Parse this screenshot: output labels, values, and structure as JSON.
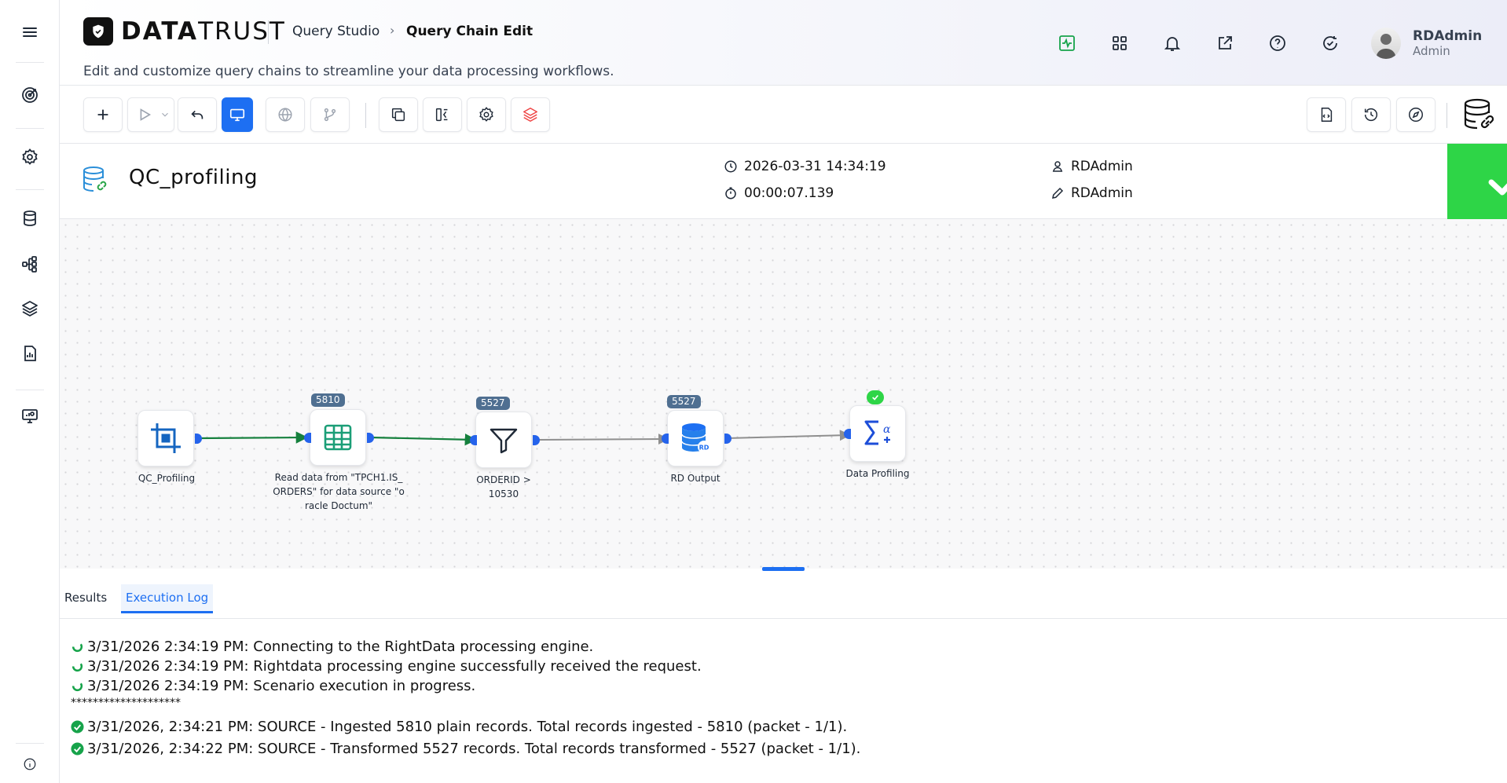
{
  "header": {
    "logo_text_bold": "DATA",
    "logo_text_rest": "TRUST",
    "breadcrumb_parent": "Query Studio",
    "breadcrumb_current": "Query Chain Edit",
    "subtitle": "Edit and customize query chains to streamline your data processing workflows.",
    "user_name": "RDAdmin",
    "user_role": "Admin",
    "icons": [
      "activity-icon",
      "grid-icon",
      "bell-icon",
      "external-link-icon",
      "help-icon",
      "refresh-check-icon"
    ]
  },
  "sidebar": {
    "items": [
      "menu-icon",
      "target-icon",
      "settings-icon",
      "database-icon",
      "hierarchy-icon",
      "layers-icon",
      "report-icon",
      "monitor-icon",
      "info-icon"
    ]
  },
  "query": {
    "title": "QC_profiling",
    "run_time": "2026-03-31 14:34:19",
    "duration": "00:00:07.139",
    "created_by": "RDAdmin",
    "modified_by": "RDAdmin",
    "status": "success",
    "status_color": "#2ed547"
  },
  "nodes": [
    {
      "id": "n1",
      "label": "QC_Profiling",
      "badge": null
    },
    {
      "id": "n2",
      "label": "Read data from \"TPCH1.IS_ ORDERS\" for data source \"o racle Doctum\"",
      "badge": "5810"
    },
    {
      "id": "n3",
      "label": "ORDERID > 10530",
      "badge": "5527"
    },
    {
      "id": "n4",
      "label": "RD Output",
      "badge": "5527"
    },
    {
      "id": "n5",
      "label": "Data Profiling",
      "badge": "check"
    }
  ],
  "tabs": {
    "results": "Results",
    "execution_log": "Execution Log",
    "active": "execution_log"
  },
  "log": [
    {
      "status": "progress",
      "text": "3/31/2026 2:34:19 PM: Connecting to the RightData processing engine."
    },
    {
      "status": "progress",
      "text": "3/31/2026 2:34:19 PM: Rightdata processing engine successfully received the request."
    },
    {
      "status": "progress",
      "text": "3/31/2026 2:34:19 PM: Scenario execution in progress."
    },
    {
      "status": "none",
      "text": "********************"
    },
    {
      "status": "done",
      "text": "3/31/2026, 2:34:21 PM: SOURCE - Ingested 5810 plain records. Total records ingested - 5810 (packet - 1/1)."
    },
    {
      "status": "done",
      "text": "3/31/2026, 2:34:22 PM: SOURCE - Transformed 5527 records. Total records transformed - 5527 (packet - 1/1)."
    }
  ]
}
